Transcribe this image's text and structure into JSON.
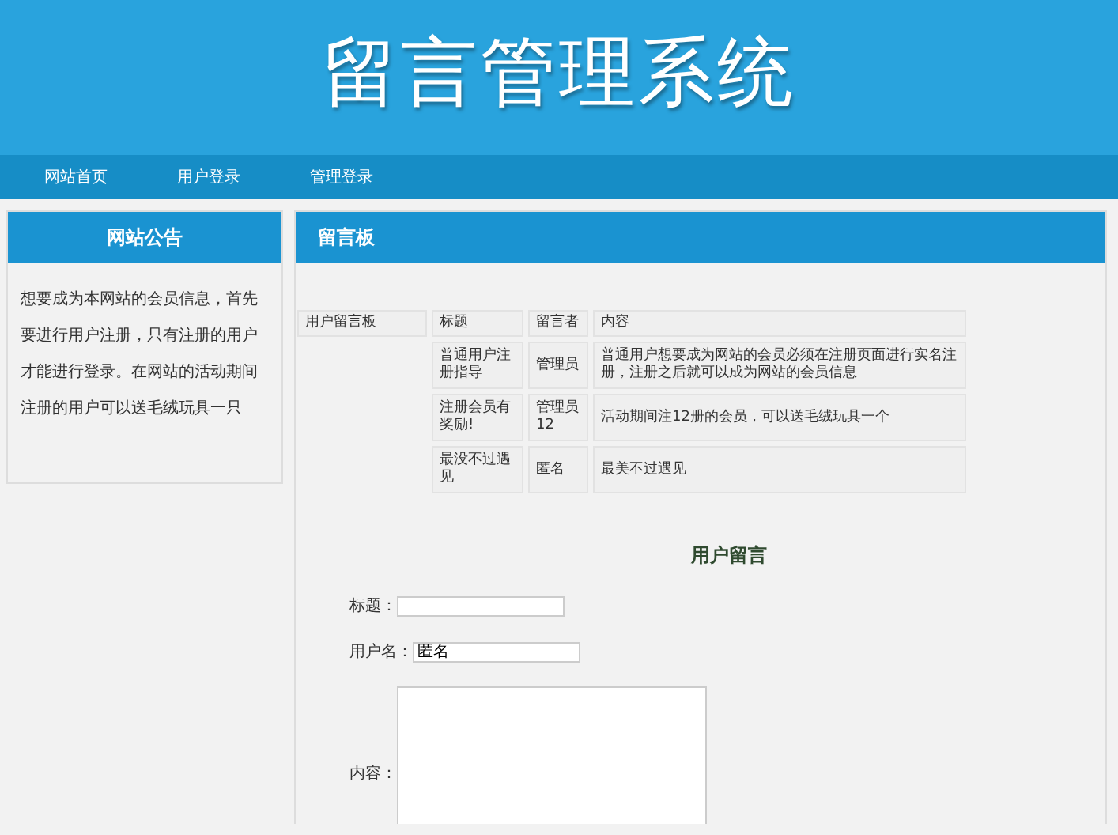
{
  "header": {
    "title": "留言管理系统"
  },
  "nav": [
    {
      "label": "网站首页"
    },
    {
      "label": "用户登录"
    },
    {
      "label": "管理登录"
    }
  ],
  "notice": {
    "title": "网站公告",
    "text": "想要成为本网站的会员信息，首先要进行用户注册，只有注册的用户才能进行登录。在网站的活动期间注册的用户可以送毛绒玩具一只"
  },
  "board": {
    "title": "留言板",
    "table": {
      "corner_label": "用户留言板",
      "columns": [
        "标题",
        "留言者",
        "内容"
      ],
      "rows": [
        [
          "普通用户注册指导",
          "管理员",
          "普通用户想要成为网站的会员必须在注册页面进行实名注册，注册之后就可以成为网站的会员信息"
        ],
        [
          "注册会员有奖励!",
          "管理员12",
          "活动期间注12册的会员，可以送毛绒玩具一个"
        ],
        [
          "最没不过遇见",
          "匿名",
          "最美不过遇见"
        ]
      ]
    },
    "form": {
      "title": "用户留言",
      "fields": [
        {
          "kind": "input",
          "label": "标题："
        },
        {
          "kind": "input",
          "label": "用户名：",
          "value": "匿名"
        },
        {
          "kind": "textarea",
          "label": "内容："
        }
      ]
    }
  }
}
